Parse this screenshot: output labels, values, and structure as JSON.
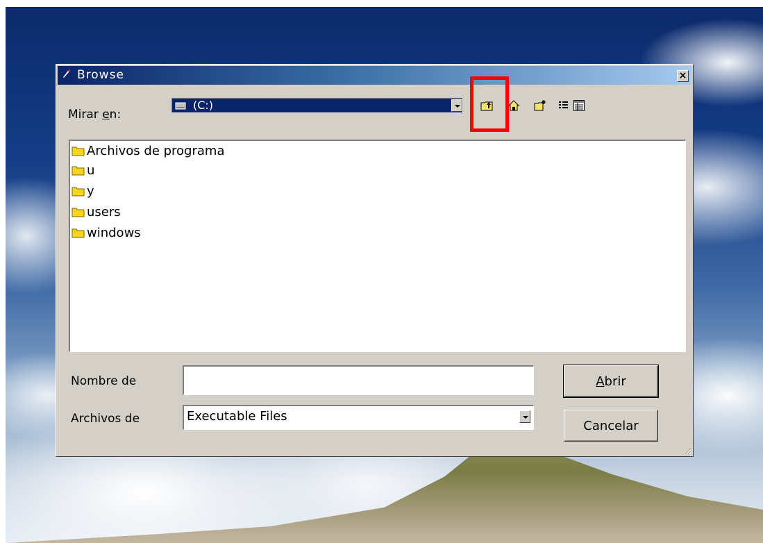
{
  "dialog": {
    "title": "Browse",
    "close_label": "×"
  },
  "look_in": {
    "label_prefix": "Mirar ",
    "label_accel": "e",
    "label_suffix": "n:",
    "value": "(C:)"
  },
  "toolbar": {
    "buttons": [
      "up-one-level",
      "home",
      "new-folder",
      "list-view",
      "details-view"
    ]
  },
  "files": [
    {
      "name": "Archivos de programa",
      "icon": "folder-icon"
    },
    {
      "name": "u",
      "icon": "folder-icon"
    },
    {
      "name": "y",
      "icon": "folder-icon"
    },
    {
      "name": "users",
      "icon": "folder-icon"
    },
    {
      "name": "windows",
      "icon": "folder-icon"
    }
  ],
  "filename": {
    "label": "Nombre de",
    "value": ""
  },
  "filetype": {
    "label": "Archivos de",
    "value": "Executable Files"
  },
  "buttons": {
    "open_accel": "A",
    "open_rest": "brir",
    "cancel": "Cancelar"
  },
  "colors": {
    "highlight": "#ff0000",
    "title_bar": "#0a246a",
    "dialog_bg": "#d4d0c8"
  }
}
